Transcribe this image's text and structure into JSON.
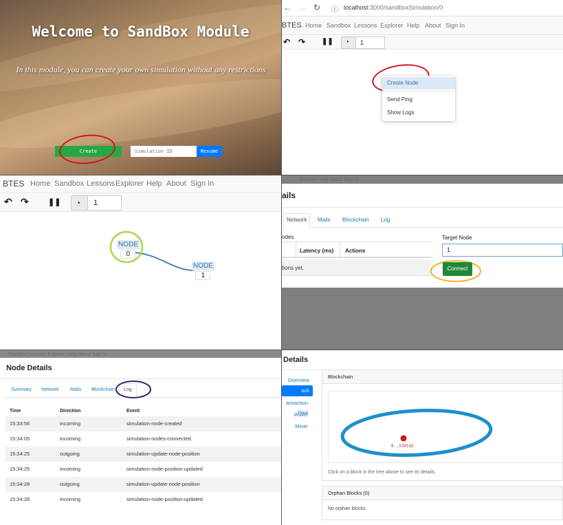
{
  "welcome": {
    "title": "Welcome to SandBox Module",
    "subtitle": "In this module, you can create your own simulation without any restrictions",
    "create_label": "Create",
    "sim_id_placeholder": "Simulation ID",
    "resume_label": "Resume"
  },
  "browser": {
    "url_host": "localhost",
    "url_rest": ":3000/sandboxSimulation/0"
  },
  "navbar": {
    "brand": "BTES",
    "links": [
      "Home",
      "Sandbox",
      "Lessons",
      "Explorer",
      "Help",
      "About",
      "Sign In"
    ]
  },
  "toolbar": {
    "speed_value": "1"
  },
  "context_menu": {
    "items": [
      "Create Node",
      "Send Ping",
      "Show Logs"
    ]
  },
  "graph": {
    "nodes": [
      {
        "label": "NODE",
        "id": "0"
      },
      {
        "label": "NODE",
        "id": "1"
      }
    ]
  },
  "network_panel": {
    "title_fragment": "ails",
    "tabs": [
      "Network",
      "Mails",
      "Blockchain",
      "Log"
    ],
    "nodes_fragment": "odes",
    "columns": [
      "Latency (ms)",
      "Actions"
    ],
    "empty_fragment": "tions yet.",
    "target_label": "Target Node",
    "target_value": "1",
    "connect_label": "Connect",
    "top_nav_fragment": "Explorer Help About Sign In"
  },
  "node_details": {
    "title": "Node Details",
    "tabs": [
      "Summary",
      "Network",
      "Mails",
      "Blockchain",
      "Log"
    ],
    "columns": [
      "Time",
      "Direction",
      "Event"
    ],
    "rows": [
      {
        "time": "15:33:56",
        "direction": "incoming",
        "event": "simulation-node-created"
      },
      {
        "time": "15:34:05",
        "direction": "incoming",
        "event": "simulation-nodes-connected"
      },
      {
        "time": "15:34:25",
        "direction": "outgoing",
        "event": "simulation-update-node-position"
      },
      {
        "time": "15:34:25",
        "direction": "incoming",
        "event": "simulation-node-position-updated"
      },
      {
        "time": "15:34:28",
        "direction": "outgoing",
        "event": "simulation-update-node-position"
      },
      {
        "time": "15:34:28",
        "direction": "incoming",
        "event": "simulation-node-position-updated"
      }
    ],
    "top_nav_fragment": "Sandbox Lessons Explorer Help About Sign In"
  },
  "blockchain_panel": {
    "title_fragment": "Details",
    "sidebar": [
      "Overview",
      "ock Database",
      "ansaction Pool",
      "Wallet",
      "Miner"
    ],
    "blockchain_header": "Blockchain",
    "block_hash": "0..339516",
    "hint": "Click on a block in the tree above to see its details.",
    "orphan_header": "Orphan Blocks (0)",
    "orphan_empty": "No orphan blocks."
  },
  "colors": {
    "green": "#28a745",
    "blue": "#007bff",
    "red_annotation": "#d0151b",
    "yellow_annotation": "#f0b429",
    "purple_annotation": "#3d1f66",
    "blue_annotation": "#1e90c8",
    "lime_annotation": "#a6d94a"
  }
}
